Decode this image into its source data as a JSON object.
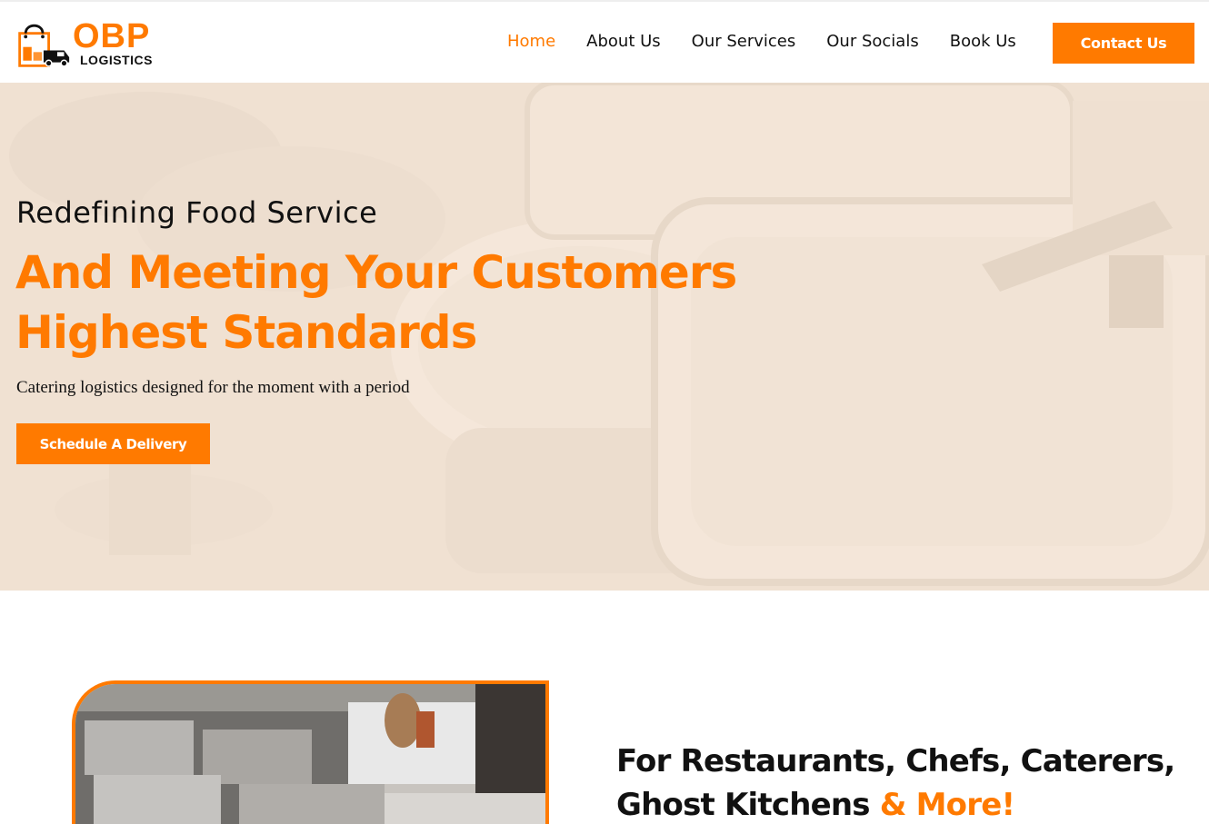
{
  "brand": {
    "name": "OBP",
    "tagline": "LOGISTICS",
    "accent_color": "#ff7a00"
  },
  "nav": {
    "items": [
      {
        "label": "Home",
        "active": true
      },
      {
        "label": "About Us",
        "active": false
      },
      {
        "label": "Our Services",
        "active": false
      },
      {
        "label": "Our Socials",
        "active": false
      },
      {
        "label": "Book Us",
        "active": false
      }
    ],
    "contact_label": "Contact Us"
  },
  "hero": {
    "subtitle": "Redefining Food Service",
    "title_line1": "And Meeting Your Customers",
    "title_line2": "Highest Standards",
    "description": "Catering logistics designed for the moment with a period",
    "cta_label": "Schedule A Delivery"
  },
  "section": {
    "heading_line1": "For Restaurants, Chefs, Caterers,",
    "heading_line2_main": "Ghost Kitchens ",
    "heading_line2_accent": "& More!"
  },
  "icons": {
    "logo": "shopping-bag-truck-icon"
  }
}
